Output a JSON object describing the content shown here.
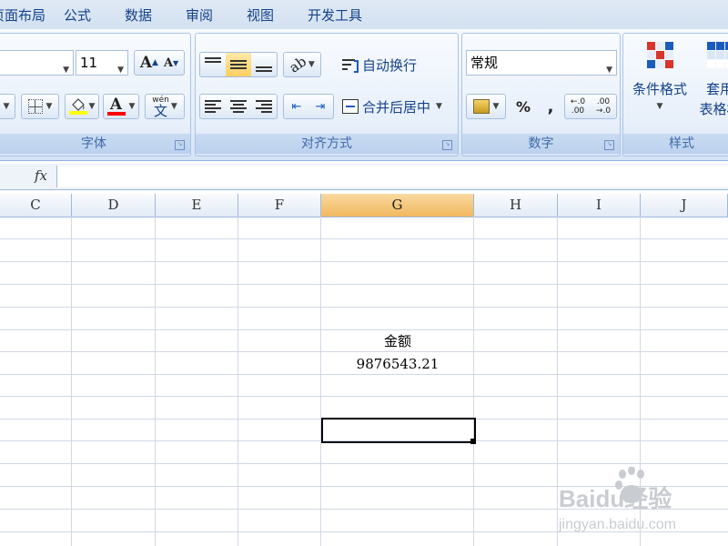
{
  "menu": {
    "tabs": [
      "页面布局",
      "公式",
      "数据",
      "审阅",
      "视图",
      "开发工具"
    ]
  },
  "ribbon": {
    "font": {
      "size": "11",
      "group_label": "字体",
      "grow": "A",
      "shrink": "A",
      "font_color_letter": "A",
      "phonetic_top": "wén",
      "phonetic_char": "文"
    },
    "align": {
      "wrap_label": "自动换行",
      "merge_label": "合并后居中",
      "group_label": "对齐方式"
    },
    "number": {
      "format": "常规",
      "percent": "%",
      "comma": ",",
      "inc_decimal": "←.0\n.00",
      "dec_decimal": ".00\n→.0",
      "group_label": "数字"
    },
    "styles": {
      "conditional_label": "条件格式",
      "table_label": "套用\n表格格",
      "group_label": "样式"
    }
  },
  "formula_bar": {
    "fx": "fx",
    "value": ""
  },
  "columns": [
    "C",
    "D",
    "E",
    "F",
    "G",
    "H",
    "I",
    "J"
  ],
  "selected_column": "G",
  "cells": {
    "g_header": "金额",
    "g_value": "9876543.21"
  },
  "watermark": {
    "brand": "Baidu经验",
    "url": "jingyan.baidu.com"
  },
  "colors": {
    "accent": "#15428b",
    "selected_header": "#f1b85f",
    "grid_line": "#d0d7e5"
  }
}
